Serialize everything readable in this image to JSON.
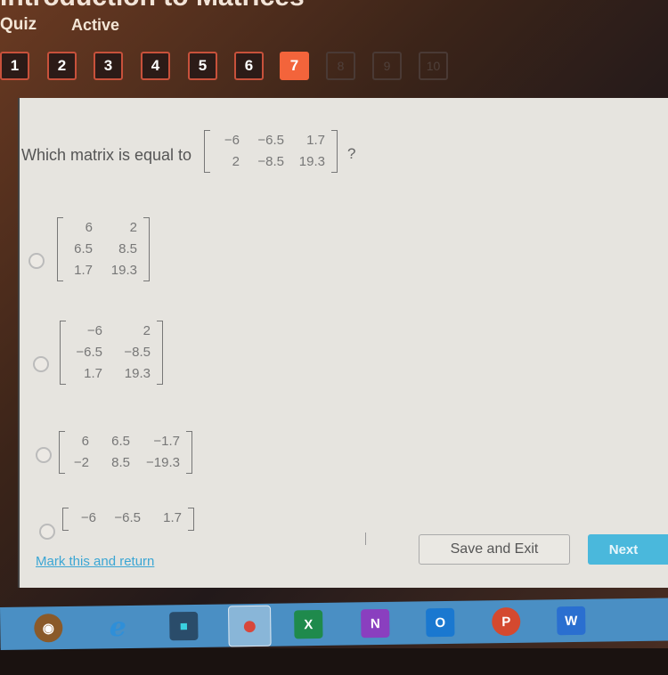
{
  "header": {
    "title": "Introduction to Matrices",
    "quiz_label": "Quiz",
    "status_label": "Active"
  },
  "question_nav": {
    "current": 7,
    "items": [
      {
        "label": "1",
        "state": "answered"
      },
      {
        "label": "2",
        "state": "answered"
      },
      {
        "label": "3",
        "state": "answered"
      },
      {
        "label": "4",
        "state": "answered"
      },
      {
        "label": "5",
        "state": "answered"
      },
      {
        "label": "6",
        "state": "answered"
      },
      {
        "label": "7",
        "state": "current"
      },
      {
        "label": "8",
        "state": "locked"
      },
      {
        "label": "9",
        "state": "locked"
      },
      {
        "label": "10",
        "state": "locked"
      }
    ]
  },
  "question": {
    "prompt": "Which matrix is equal to",
    "suffix": "?",
    "matrix": [
      [
        "−6",
        "−6.5",
        "1.7"
      ],
      [
        "2",
        "−8.5",
        "19.3"
      ]
    ]
  },
  "options": [
    {
      "matrix": [
        [
          "6",
          "2"
        ],
        [
          "6.5",
          "8.5"
        ],
        [
          "1.7",
          "19.3"
        ]
      ],
      "selected": false
    },
    {
      "matrix": [
        [
          "−6",
          "2"
        ],
        [
          "−6.5",
          "−8.5"
        ],
        [
          "1.7",
          "19.3"
        ]
      ],
      "selected": false
    },
    {
      "matrix": [
        [
          "6",
          "6.5",
          "−1.7"
        ],
        [
          "−2",
          "8.5",
          "−19.3"
        ]
      ],
      "selected": false
    },
    {
      "matrix": [
        [
          "−6",
          "−6.5",
          "1.7"
        ]
      ],
      "selected": false
    }
  ],
  "footer": {
    "mark_link": "Mark this and return",
    "save_label": "Save and Exit",
    "next_label": "Next"
  },
  "taskbar": {
    "apps": [
      {
        "name": "media-player",
        "glyph": "◉",
        "color": "#c98a2e"
      },
      {
        "name": "internet-explorer",
        "glyph": "e",
        "color": "#2f8fd8"
      },
      {
        "name": "video-editor",
        "glyph": "■",
        "color": "#2a4c6a"
      },
      {
        "name": "chrome",
        "glyph": "●",
        "color": "#d8473b"
      },
      {
        "name": "excel",
        "glyph": "X",
        "color": "#1f8a4c"
      },
      {
        "name": "onenote",
        "glyph": "N",
        "color": "#8a3fbf"
      },
      {
        "name": "outlook",
        "glyph": "O",
        "color": "#1a78d0"
      },
      {
        "name": "powerpoint",
        "glyph": "P",
        "color": "#d4492f"
      },
      {
        "name": "word",
        "glyph": "W",
        "color": "#2a6fd0"
      }
    ]
  }
}
